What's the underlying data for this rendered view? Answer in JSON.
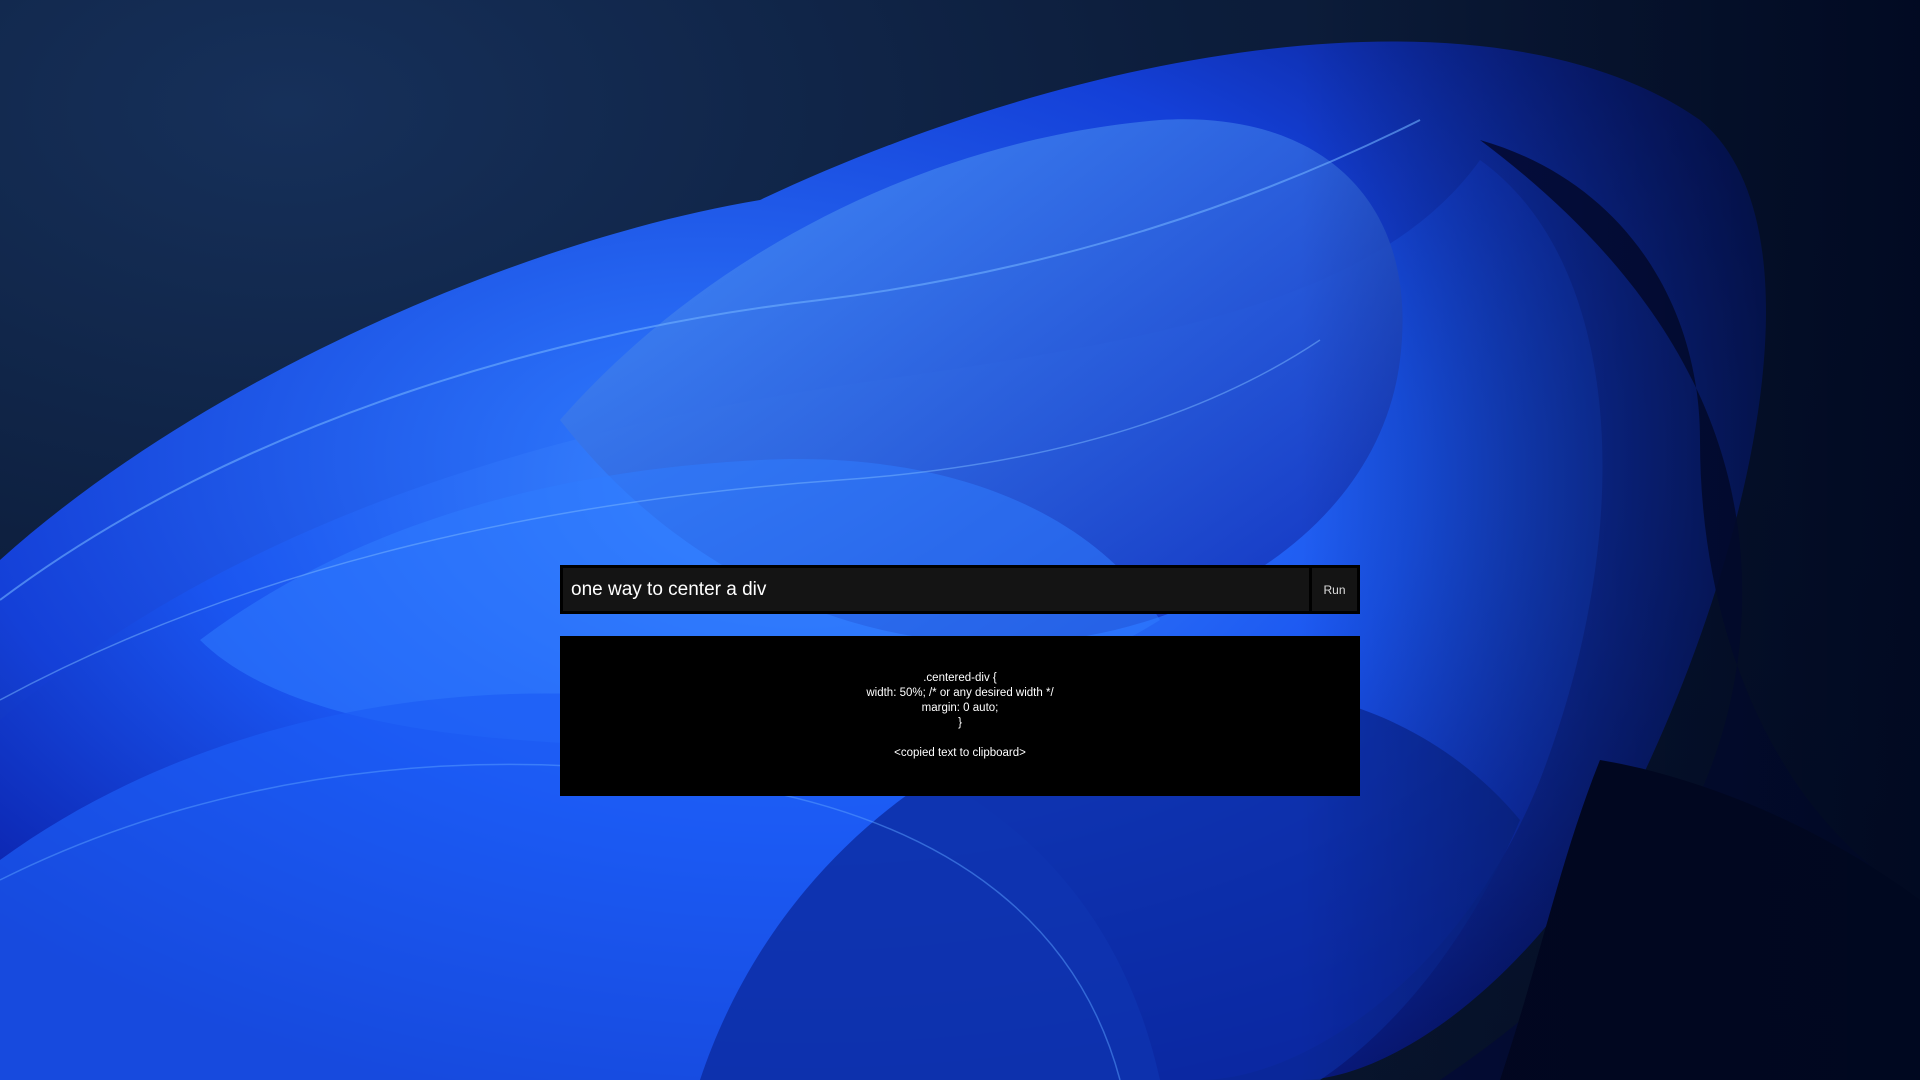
{
  "launcher": {
    "query_value": "one way to center a div",
    "run_label": "Run"
  },
  "result": {
    "code_lines": [
      ".centered-div {",
      "width: 50%; /* or any desired width */",
      "margin: 0 auto;",
      "}"
    ],
    "status_text": "<copied text to clipboard>"
  },
  "colors": {
    "panel_background": "#000000",
    "input_background": "#141414",
    "text": "#ffffff",
    "wallpaper_accent": "#1f5cff"
  },
  "icons": {
    "wallpaper": "windows-bloom-wallpaper"
  }
}
